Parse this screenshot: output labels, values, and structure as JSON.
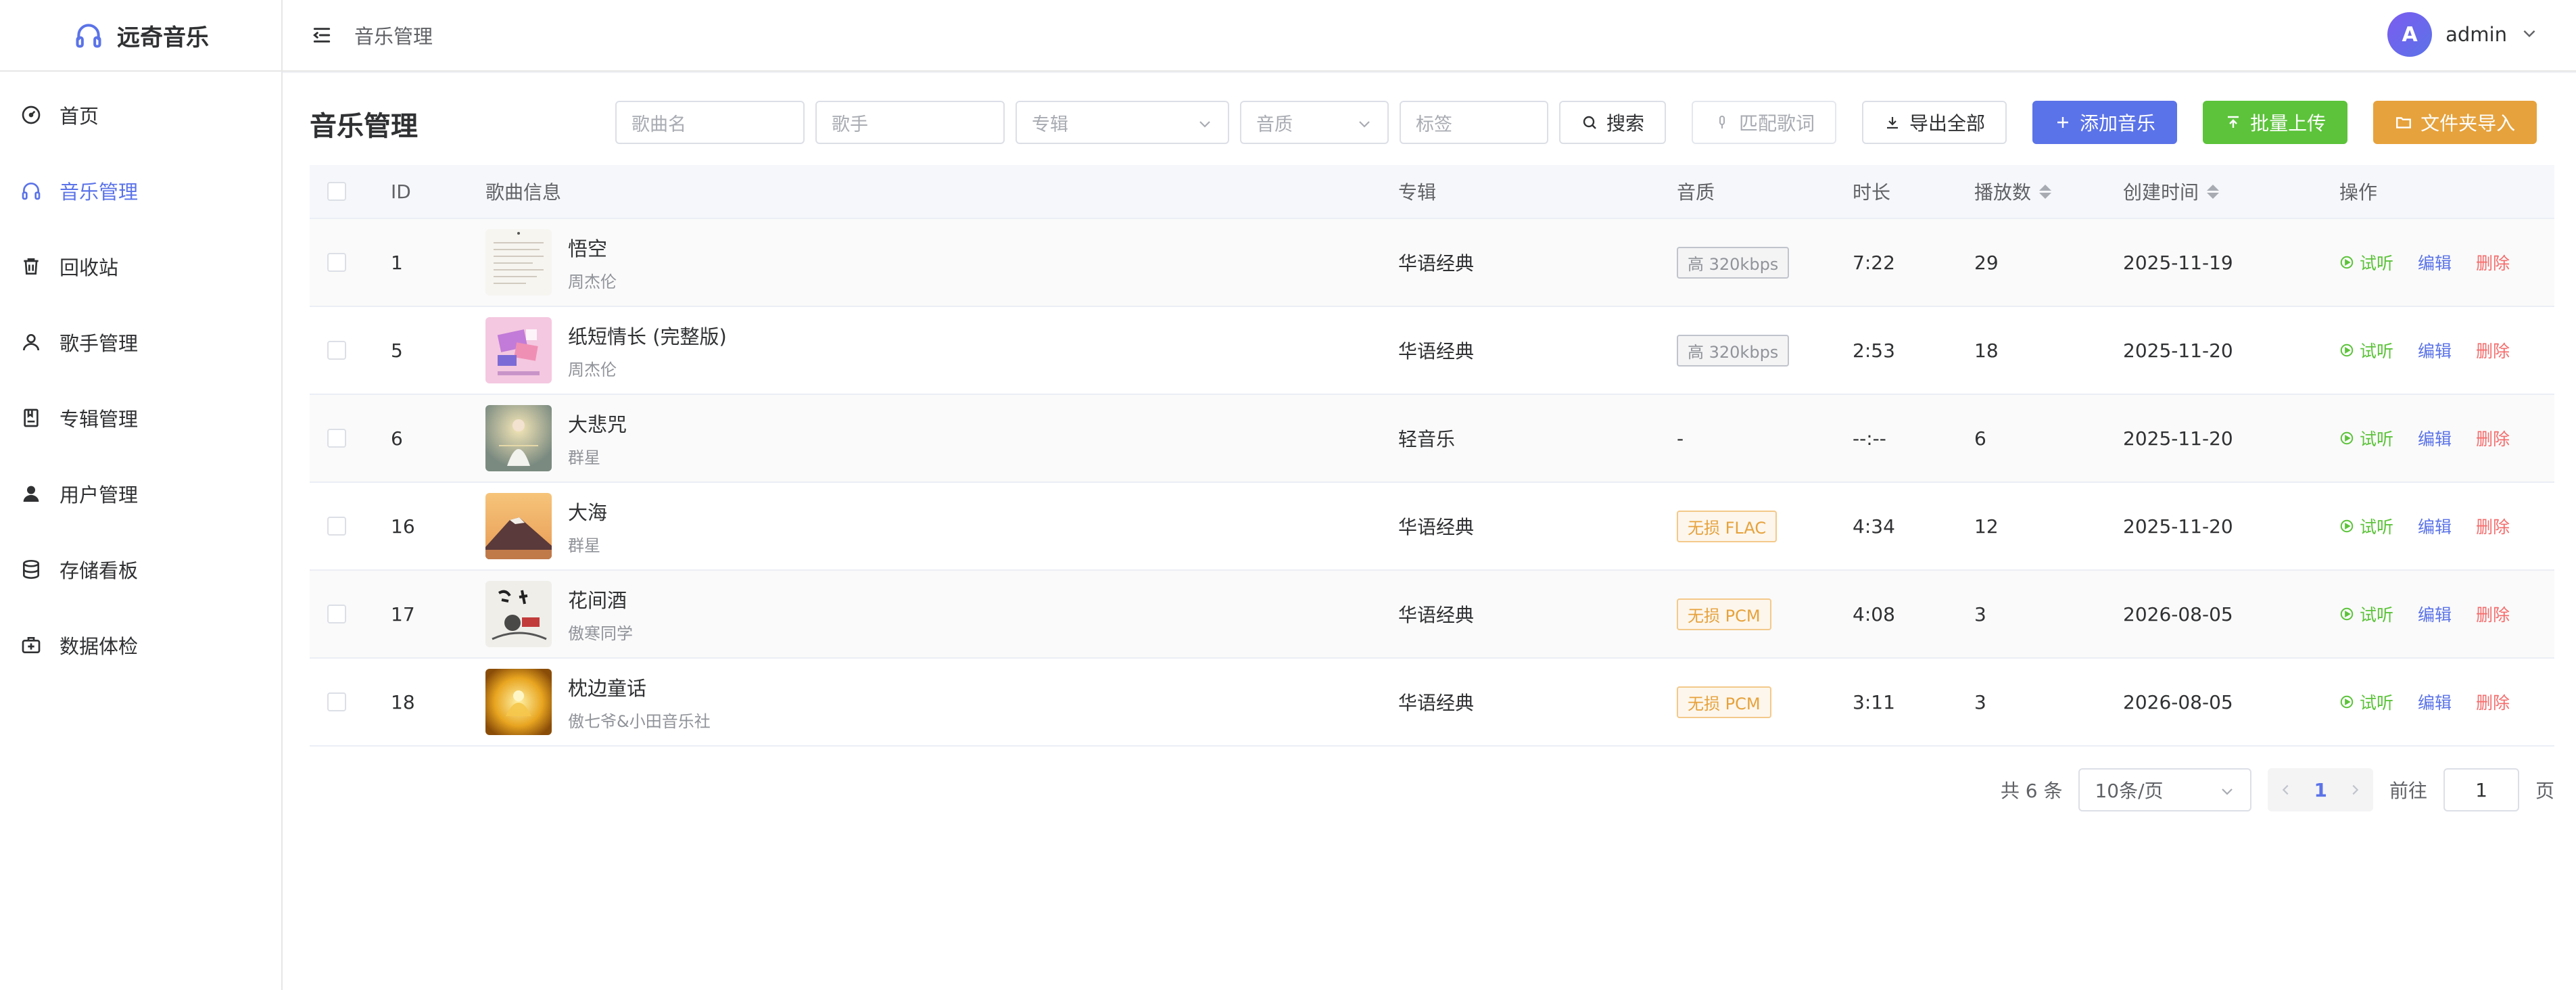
{
  "app": {
    "name": "远奇音乐"
  },
  "sidebar": {
    "items": [
      {
        "label": "首页",
        "icon": "dashboard-icon",
        "active": false
      },
      {
        "label": "音乐管理",
        "icon": "headphones-icon",
        "active": true
      },
      {
        "label": "回收站",
        "icon": "trash-icon",
        "active": false
      },
      {
        "label": "歌手管理",
        "icon": "user-outline-icon",
        "active": false
      },
      {
        "label": "专辑管理",
        "icon": "album-icon",
        "active": false
      },
      {
        "label": "用户管理",
        "icon": "user-filled-icon",
        "active": false
      },
      {
        "label": "存储看板",
        "icon": "database-icon",
        "active": false
      },
      {
        "label": "数据体检",
        "icon": "first-aid-icon",
        "active": false
      }
    ]
  },
  "header": {
    "breadcrumb": "音乐管理",
    "user": {
      "avatar_letter": "A",
      "name": "admin"
    }
  },
  "page": {
    "title": "音乐管理"
  },
  "filters": {
    "song_placeholder": "歌曲名",
    "artist_placeholder": "歌手",
    "album_placeholder": "专辑",
    "quality_placeholder": "音质",
    "tag_placeholder": "标签"
  },
  "buttons": {
    "search": "搜索",
    "match_lyrics": "匹配歌词",
    "export_all": "导出全部",
    "add_music": "添加音乐",
    "batch_upload": "批量上传",
    "folder_import": "文件夹导入"
  },
  "table": {
    "columns": {
      "id": "ID",
      "song_info": "歌曲信息",
      "album": "专辑",
      "quality": "音质",
      "duration": "时长",
      "plays": "播放数",
      "created": "创建时间",
      "actions": "操作"
    },
    "rows": [
      {
        "id": "1",
        "title": "悟空",
        "artist": "周杰伦",
        "album": "华语经典",
        "quality": "高 320kbps",
        "quality_type": "normal",
        "duration": "7:22",
        "plays": "29",
        "created": "2025-11-19",
        "cover": "paper"
      },
      {
        "id": "5",
        "title": "纸短情长 (完整版)",
        "artist": "周杰伦",
        "album": "华语经典",
        "quality": "高 320kbps",
        "quality_type": "normal",
        "duration": "2:53",
        "plays": "18",
        "created": "2025-11-20",
        "cover": "pink"
      },
      {
        "id": "6",
        "title": "大悲咒",
        "artist": "群星",
        "album": "轻音乐",
        "quality": "-",
        "quality_type": "none",
        "duration": "--:--",
        "plays": "6",
        "created": "2025-11-20",
        "cover": "buddha"
      },
      {
        "id": "16",
        "title": "大海",
        "artist": "群星",
        "album": "华语经典",
        "quality": "无损 FLAC",
        "quality_type": "warn",
        "duration": "4:34",
        "plays": "12",
        "created": "2025-11-20",
        "cover": "mountain"
      },
      {
        "id": "17",
        "title": "花间酒",
        "artist": "傲寒同学",
        "album": "华语经典",
        "quality": "无损 PCM",
        "quality_type": "warn",
        "duration": "4:08",
        "plays": "3",
        "created": "2026-08-05",
        "cover": "ink"
      },
      {
        "id": "18",
        "title": "枕边童话",
        "artist": "傲七爷&小田音乐社",
        "album": "华语经典",
        "quality": "无损 PCM",
        "quality_type": "warn",
        "duration": "3:11",
        "plays": "3",
        "created": "2026-08-05",
        "cover": "gold"
      }
    ],
    "actions": {
      "listen": "试听",
      "edit": "编辑",
      "delete": "删除"
    }
  },
  "pagination": {
    "total_text": "共 6 条",
    "page_size": "10条/页",
    "current_page": "1",
    "goto_label": "前往",
    "goto_value": "1",
    "page_suffix": "页"
  },
  "colors": {
    "primary": "#5b73e8",
    "success": "#5cc33a",
    "warning": "#e6a23c",
    "danger": "#f56c6c"
  }
}
